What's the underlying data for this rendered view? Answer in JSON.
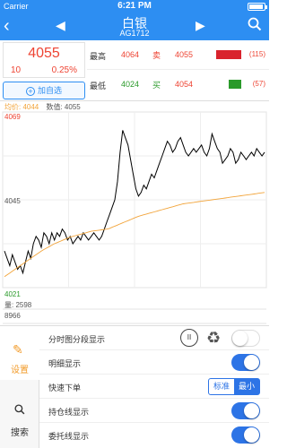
{
  "status": {
    "carrier": "Carrier",
    "time": "6:21 PM"
  },
  "nav": {
    "title": "白银",
    "subtitle": "AG1712"
  },
  "quote": {
    "price": "4055",
    "change": "10",
    "change_pct": "0.25%",
    "add_label": "加自选",
    "high": {
      "label": "最高",
      "value": "4064",
      "side": "卖",
      "side_price": "4055",
      "count": "(115)",
      "bar_color": "#d9232d",
      "bar_level": 1.0
    },
    "low": {
      "label": "最低",
      "value": "4024",
      "side": "买",
      "side_price": "4054",
      "count": "(57)",
      "bar_color": "#2a9a2a",
      "bar_level": 0.5
    }
  },
  "chart_data": {
    "type": "line",
    "avg_label": "均价: 4044",
    "value_label": "数值: 4055",
    "y_ticks": [
      "4069",
      "4045",
      "4021"
    ],
    "ylim": [
      4021,
      4069
    ],
    "volume_label": "量: 2598",
    "volume_max": "8966",
    "grid": true,
    "series": [
      {
        "values": [
          4031,
          4029,
          4027,
          4030,
          4028,
          4026,
          4027,
          4025,
          4028,
          4031,
          4029,
          4033,
          4035,
          4034,
          4032,
          4036,
          4035,
          4033,
          4036,
          4034,
          4036,
          4035,
          4037,
          4036,
          4034,
          4035,
          4033,
          4034,
          4035,
          4034,
          4036,
          4035,
          4034,
          4035,
          4036,
          4035,
          4034,
          4035,
          4037,
          4039,
          4041,
          4043,
          4045,
          4050,
          4058,
          4064,
          4062,
          4060,
          4056,
          4052,
          4048,
          4046,
          4047,
          4049,
          4048,
          4050,
          4052,
          4051,
          4053,
          4055,
          4057,
          4059,
          4061,
          4060,
          4058,
          4059,
          4061,
          4062,
          4060,
          4058,
          4057,
          4058,
          4059,
          4058,
          4059,
          4060,
          4058,
          4057,
          4059,
          4063,
          4061,
          4059,
          4058,
          4055,
          4056,
          4057,
          4059,
          4058,
          4055,
          4056,
          4058,
          4057,
          4056,
          4057,
          4058,
          4057,
          4059,
          4058,
          4057,
          4058
        ],
        "color": "#000000"
      },
      {
        "values": [
          4024,
          4024.5,
          4025,
          4025.5,
          4026,
          4026.5,
          4027,
          4027.5,
          4028,
          4028.5,
          4029,
          4029.5,
          4030,
          4030.5,
          4031,
          4031.4,
          4031.8,
          4032.2,
          4032.6,
          4033,
          4033.3,
          4033.6,
          4033.9,
          4034.2,
          4034.5,
          4034.8,
          4035,
          4035.2,
          4035.4,
          4035.6,
          4035.8,
          4036,
          4036.2,
          4036.4,
          4036.5,
          4036.6,
          4036.7,
          4036.8,
          4036.9,
          4037,
          4037.2,
          4037.5,
          4037.8,
          4038.1,
          4038.4,
          4038.7,
          4039,
          4039.3,
          4039.6,
          4039.9,
          4040.2,
          4040.5,
          4040.7,
          4040.9,
          4041.1,
          4041.3,
          4041.5,
          4041.7,
          4041.9,
          4042.1,
          4042.3,
          4042.5,
          4042.7,
          4042.9,
          4043.1,
          4043.3,
          4043.5,
          4043.7,
          4043.9,
          4044,
          4044.1,
          4044.2,
          4044.3,
          4044.4,
          4044.5,
          4044.6,
          4044.7,
          4044.8,
          4044.9,
          4045,
          4045.1,
          4045.2,
          4045.3,
          4045.4,
          4045.5,
          4045.6,
          4045.7,
          4045.8,
          4045.9,
          4046,
          4046.1,
          4046.2,
          4046.3,
          4046.4,
          4046.5,
          4046.6,
          4046.7,
          4046.8,
          4046.9,
          4047
        ],
        "color": "#f2a43a"
      }
    ]
  },
  "tabs": [
    {
      "icon": "wrench-icon",
      "label": "设置"
    },
    {
      "icon": "search-icon",
      "label": "搜索"
    }
  ],
  "settings": {
    "segment_display": {
      "label": "分时图分段显示",
      "on": false,
      "pause_glyph": "II",
      "recycle_glyph": "♻"
    },
    "detail_display": {
      "label": "明细显示",
      "on": true
    },
    "quick_order": {
      "label": "快速下单",
      "options": [
        "标准",
        "最小"
      ],
      "selected": "最小"
    },
    "position_line": {
      "label": "持仓线显示",
      "on": true
    },
    "order_line": {
      "label": "委托线显示",
      "on": true
    }
  }
}
